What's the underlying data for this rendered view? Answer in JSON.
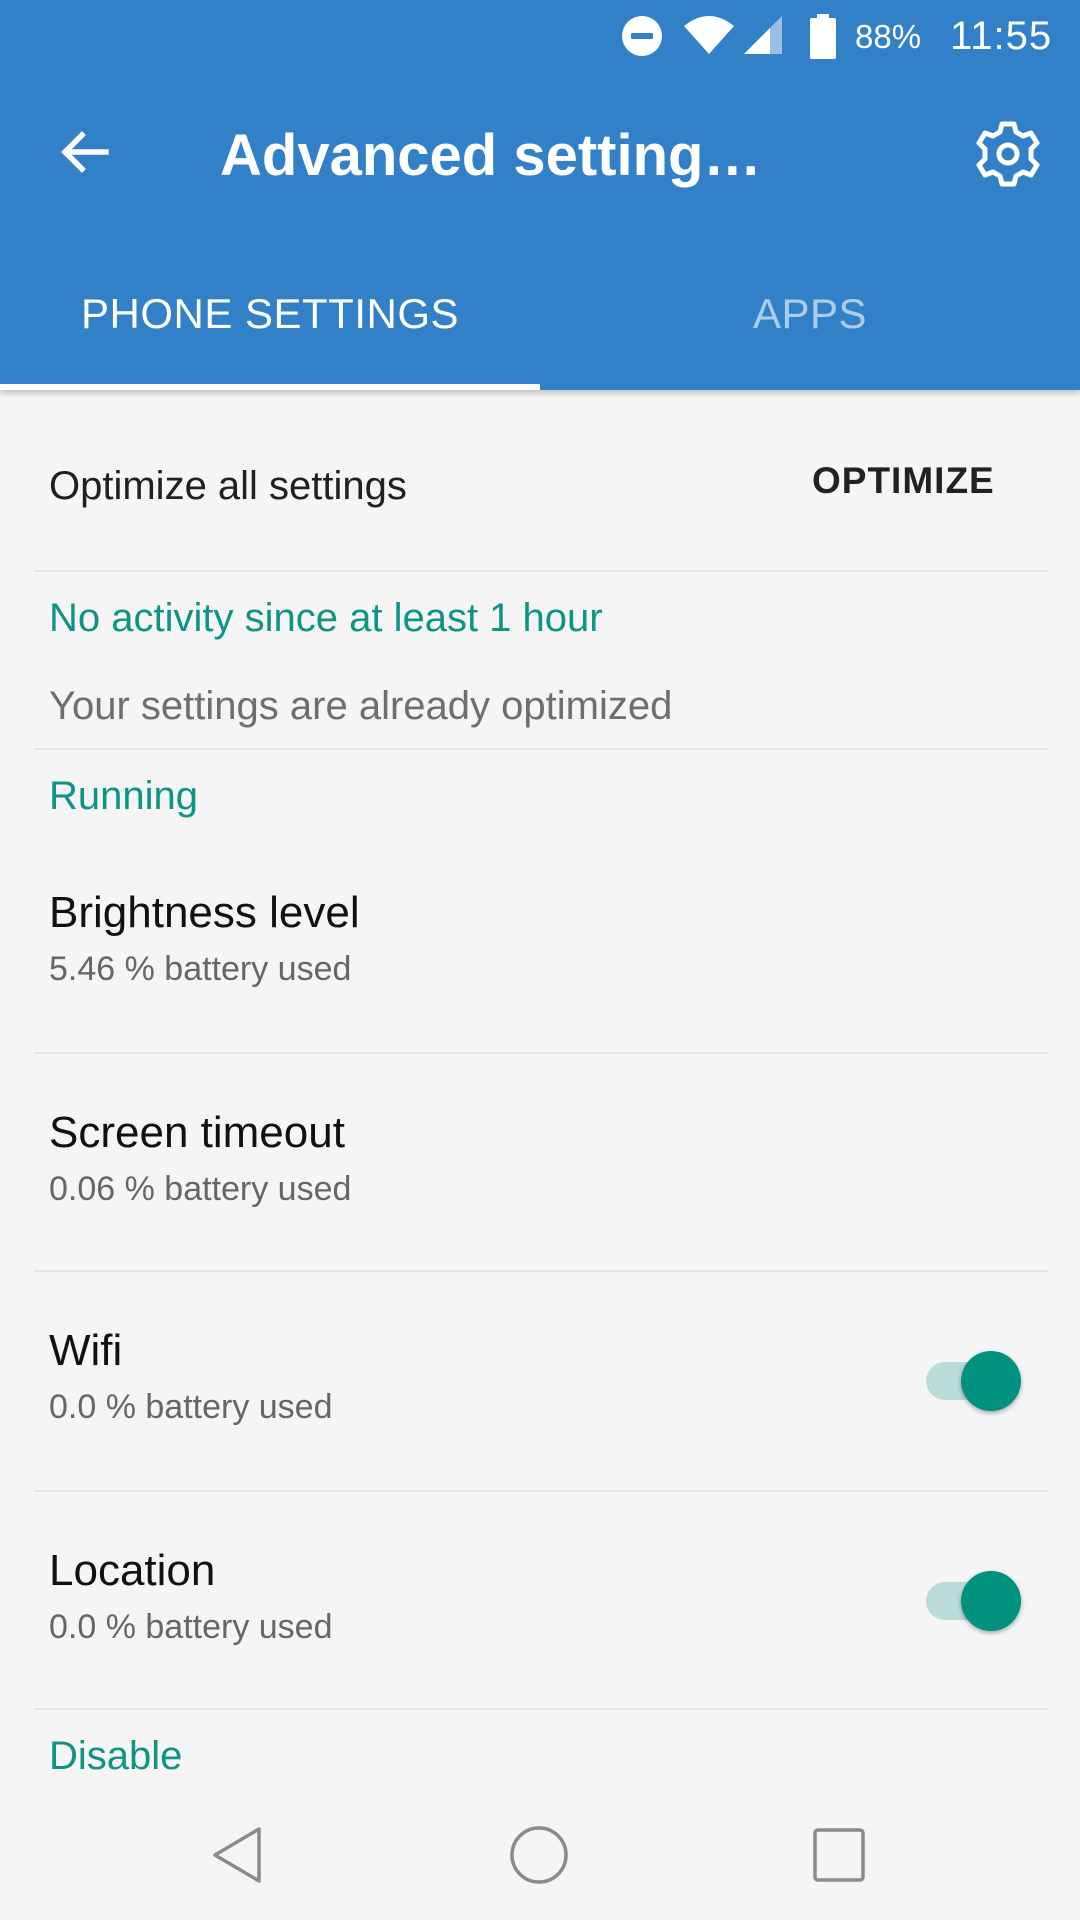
{
  "status_bar": {
    "battery_percent": "88%",
    "time": "11:55",
    "icons": [
      "do-not-disturb-icon",
      "wifi-icon",
      "cell-signal-icon",
      "battery-icon"
    ]
  },
  "app_bar": {
    "title": "Advanced setting…",
    "back_icon": "arrow-left-icon",
    "settings_icon": "gear-icon"
  },
  "tabs": [
    {
      "label": "PHONE SETTINGS",
      "selected": true
    },
    {
      "label": "APPS",
      "selected": false
    }
  ],
  "optimize_row": {
    "label": "Optimize all settings",
    "button_label": "OPTIMIZE"
  },
  "inactivity": {
    "header": "No activity since at least 1 hour",
    "summary": "Your settings are already optimized"
  },
  "running": {
    "header": "Running",
    "items": [
      {
        "title": "Brightness level",
        "subtitle": "5.46 % battery used",
        "has_toggle": false
      },
      {
        "title": "Screen timeout",
        "subtitle": "0.06 % battery used",
        "has_toggle": false
      },
      {
        "title": "Wifi",
        "subtitle": "0.0 % battery used",
        "has_toggle": true,
        "toggle_on": true
      },
      {
        "title": "Location",
        "subtitle": "0.0 % battery used",
        "has_toggle": true,
        "toggle_on": true
      }
    ]
  },
  "disable": {
    "header": "Disable"
  },
  "colors": {
    "primary": "#3280c8",
    "accent": "#0f9484",
    "background": "#f5f5f5"
  },
  "nav_bar": {
    "icons": [
      "nav-back-icon",
      "nav-home-icon",
      "nav-recents-icon"
    ]
  }
}
